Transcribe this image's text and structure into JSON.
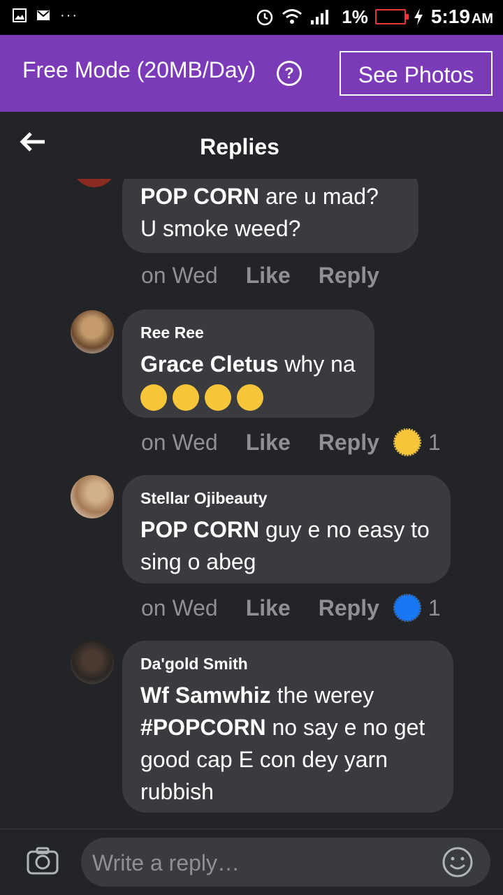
{
  "statusbar": {
    "battery_pct": "1%",
    "time": "5:19",
    "ampm": "AM",
    "dots": "···"
  },
  "freebar": {
    "text": "Free Mode (20MB/Day)",
    "help": "?",
    "button": "See Photos"
  },
  "header": {
    "title": "Replies"
  },
  "comments": [
    {
      "name": "",
      "tag": "POP CORN",
      "text": " are u mad? U smoke weed?",
      "time": "on Wed",
      "like": "Like",
      "reply": "Reply"
    },
    {
      "name": "Ree Ree",
      "tag": "Grace Cletus",
      "text": " why na",
      "time": "on Wed",
      "like": "Like",
      "reply": "Reply",
      "reaction_count": "1"
    },
    {
      "name": "Stellar Ojibeauty",
      "tag": "POP CORN",
      "text": " guy e no easy to sing o abeg",
      "time": "on Wed",
      "like": "Like",
      "reply": "Reply",
      "reaction_count": "1"
    },
    {
      "name": "Da'gold Smith",
      "tag": "Wf Samwhiz",
      "text": " the werey",
      "tag2": "#POPCORN",
      "text2": "  no say e no get good cap E con dey yarn rubbish"
    }
  ],
  "reply_input": {
    "placeholder": "Write a reply…"
  }
}
